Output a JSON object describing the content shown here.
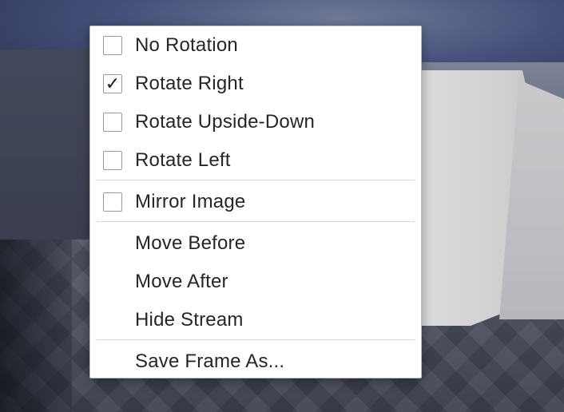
{
  "menu": {
    "items": [
      {
        "label": "No Rotation",
        "checkable": true,
        "checked": false
      },
      {
        "label": "Rotate Right",
        "checkable": true,
        "checked": true
      },
      {
        "label": "Rotate Upside-Down",
        "checkable": true,
        "checked": false
      },
      {
        "label": "Rotate Left",
        "checkable": true,
        "checked": false
      },
      {
        "label": "Mirror Image",
        "checkable": true,
        "checked": false
      },
      {
        "label": "Move Before",
        "checkable": false
      },
      {
        "label": "Move After",
        "checkable": false
      },
      {
        "label": "Hide Stream",
        "checkable": false
      },
      {
        "label": "Save Frame As...",
        "checkable": false
      }
    ],
    "check_glyph": "✓"
  }
}
